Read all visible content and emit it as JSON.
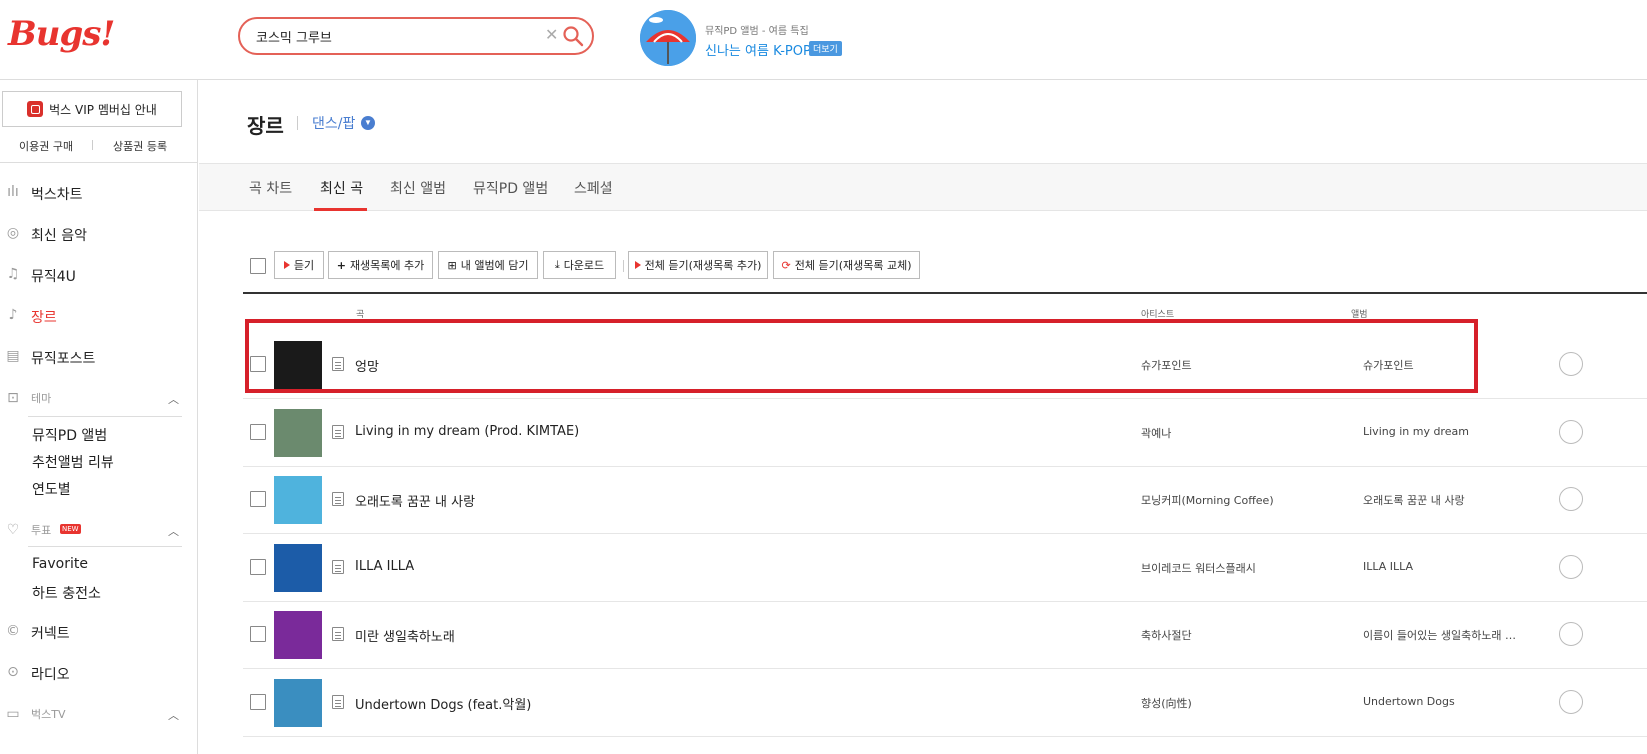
{
  "header": {
    "logo": "Bugs!",
    "search": {
      "value": "코스믹 그루브",
      "placeholder": ""
    },
    "promo": {
      "small": "뮤직PD 앨범 - 여름 특집",
      "title": "신나는 여름 K-POP",
      "more": "더보기"
    }
  },
  "sidebar": {
    "vip": "벅스 VIP 멤버십 안내",
    "links": [
      "이용권 구매",
      "상품권 등록"
    ],
    "nav": [
      {
        "label": "벅스차트",
        "icon": "chart-icon"
      },
      {
        "label": "최신 음악",
        "icon": "new-music-icon"
      },
      {
        "label": "뮤직4U",
        "icon": "music-note-icon"
      },
      {
        "label": "장르",
        "icon": "guitar-icon",
        "active": true
      },
      {
        "label": "뮤직포스트",
        "icon": "post-icon"
      }
    ],
    "theme": {
      "label": "테마",
      "items": [
        "뮤직PD 앨범",
        "추천앨범 리뷰",
        "연도별"
      ]
    },
    "vote": {
      "label": "투표",
      "badge": "NEW",
      "items": [
        "Favorite",
        "하트 충전소"
      ]
    },
    "bottom": [
      {
        "label": "커넥트",
        "icon": "connect-icon"
      },
      {
        "label": "라디오",
        "icon": "radio-icon"
      },
      {
        "label": "벅스TV",
        "icon": "tv-icon"
      }
    ]
  },
  "main": {
    "title": "장르",
    "genre": "댄스/팝",
    "tabs": [
      "곡 차트",
      "최신 곡",
      "최신 앨범",
      "뮤직PD 앨범",
      "스페셜"
    ],
    "active_tab": "최신 곡",
    "toolbar": {
      "listen": "듣기",
      "add_playlist": "재생목록에 추가",
      "my_album": "내 앨범에 담기",
      "download": "다운로드",
      "play_all_add": "전체 듣기(재생목록 추가)",
      "play_all_replace": "전체 듣기(재생목록 교체)"
    },
    "columns": {
      "song": "곡",
      "artist": "아티스트",
      "album": "앨범"
    },
    "rows": [
      {
        "song": "엉망",
        "artist": "슈가포인트",
        "album": "슈가포인트",
        "cover": "#1a1a1a"
      },
      {
        "song": "Living in my dream (Prod. KIMTAE)",
        "artist": "곽예나",
        "album": "Living in my dream",
        "cover": "#6b8a6e"
      },
      {
        "song": "오래도록 꿈꾼 내 사랑",
        "artist": "모닝커피(Morning Coffee)",
        "album": "오래도록 꿈꾼 내 사랑",
        "cover": "#4fb3dd"
      },
      {
        "song": "ILLA ILLA",
        "artist": "브이레코드 워터스플래시",
        "album": "ILLA ILLA",
        "cover": "#1c5ca8"
      },
      {
        "song": "미란 생일축하노래",
        "artist": "축하사절단",
        "album": "이름이 들어있는 생일축하노래 …",
        "cover": "#7a2a9a"
      },
      {
        "song": "Undertown Dogs (feat.악월)",
        "artist": "향성(向性)",
        "album": "Undertown Dogs",
        "cover": "#3a8ec0"
      }
    ]
  }
}
